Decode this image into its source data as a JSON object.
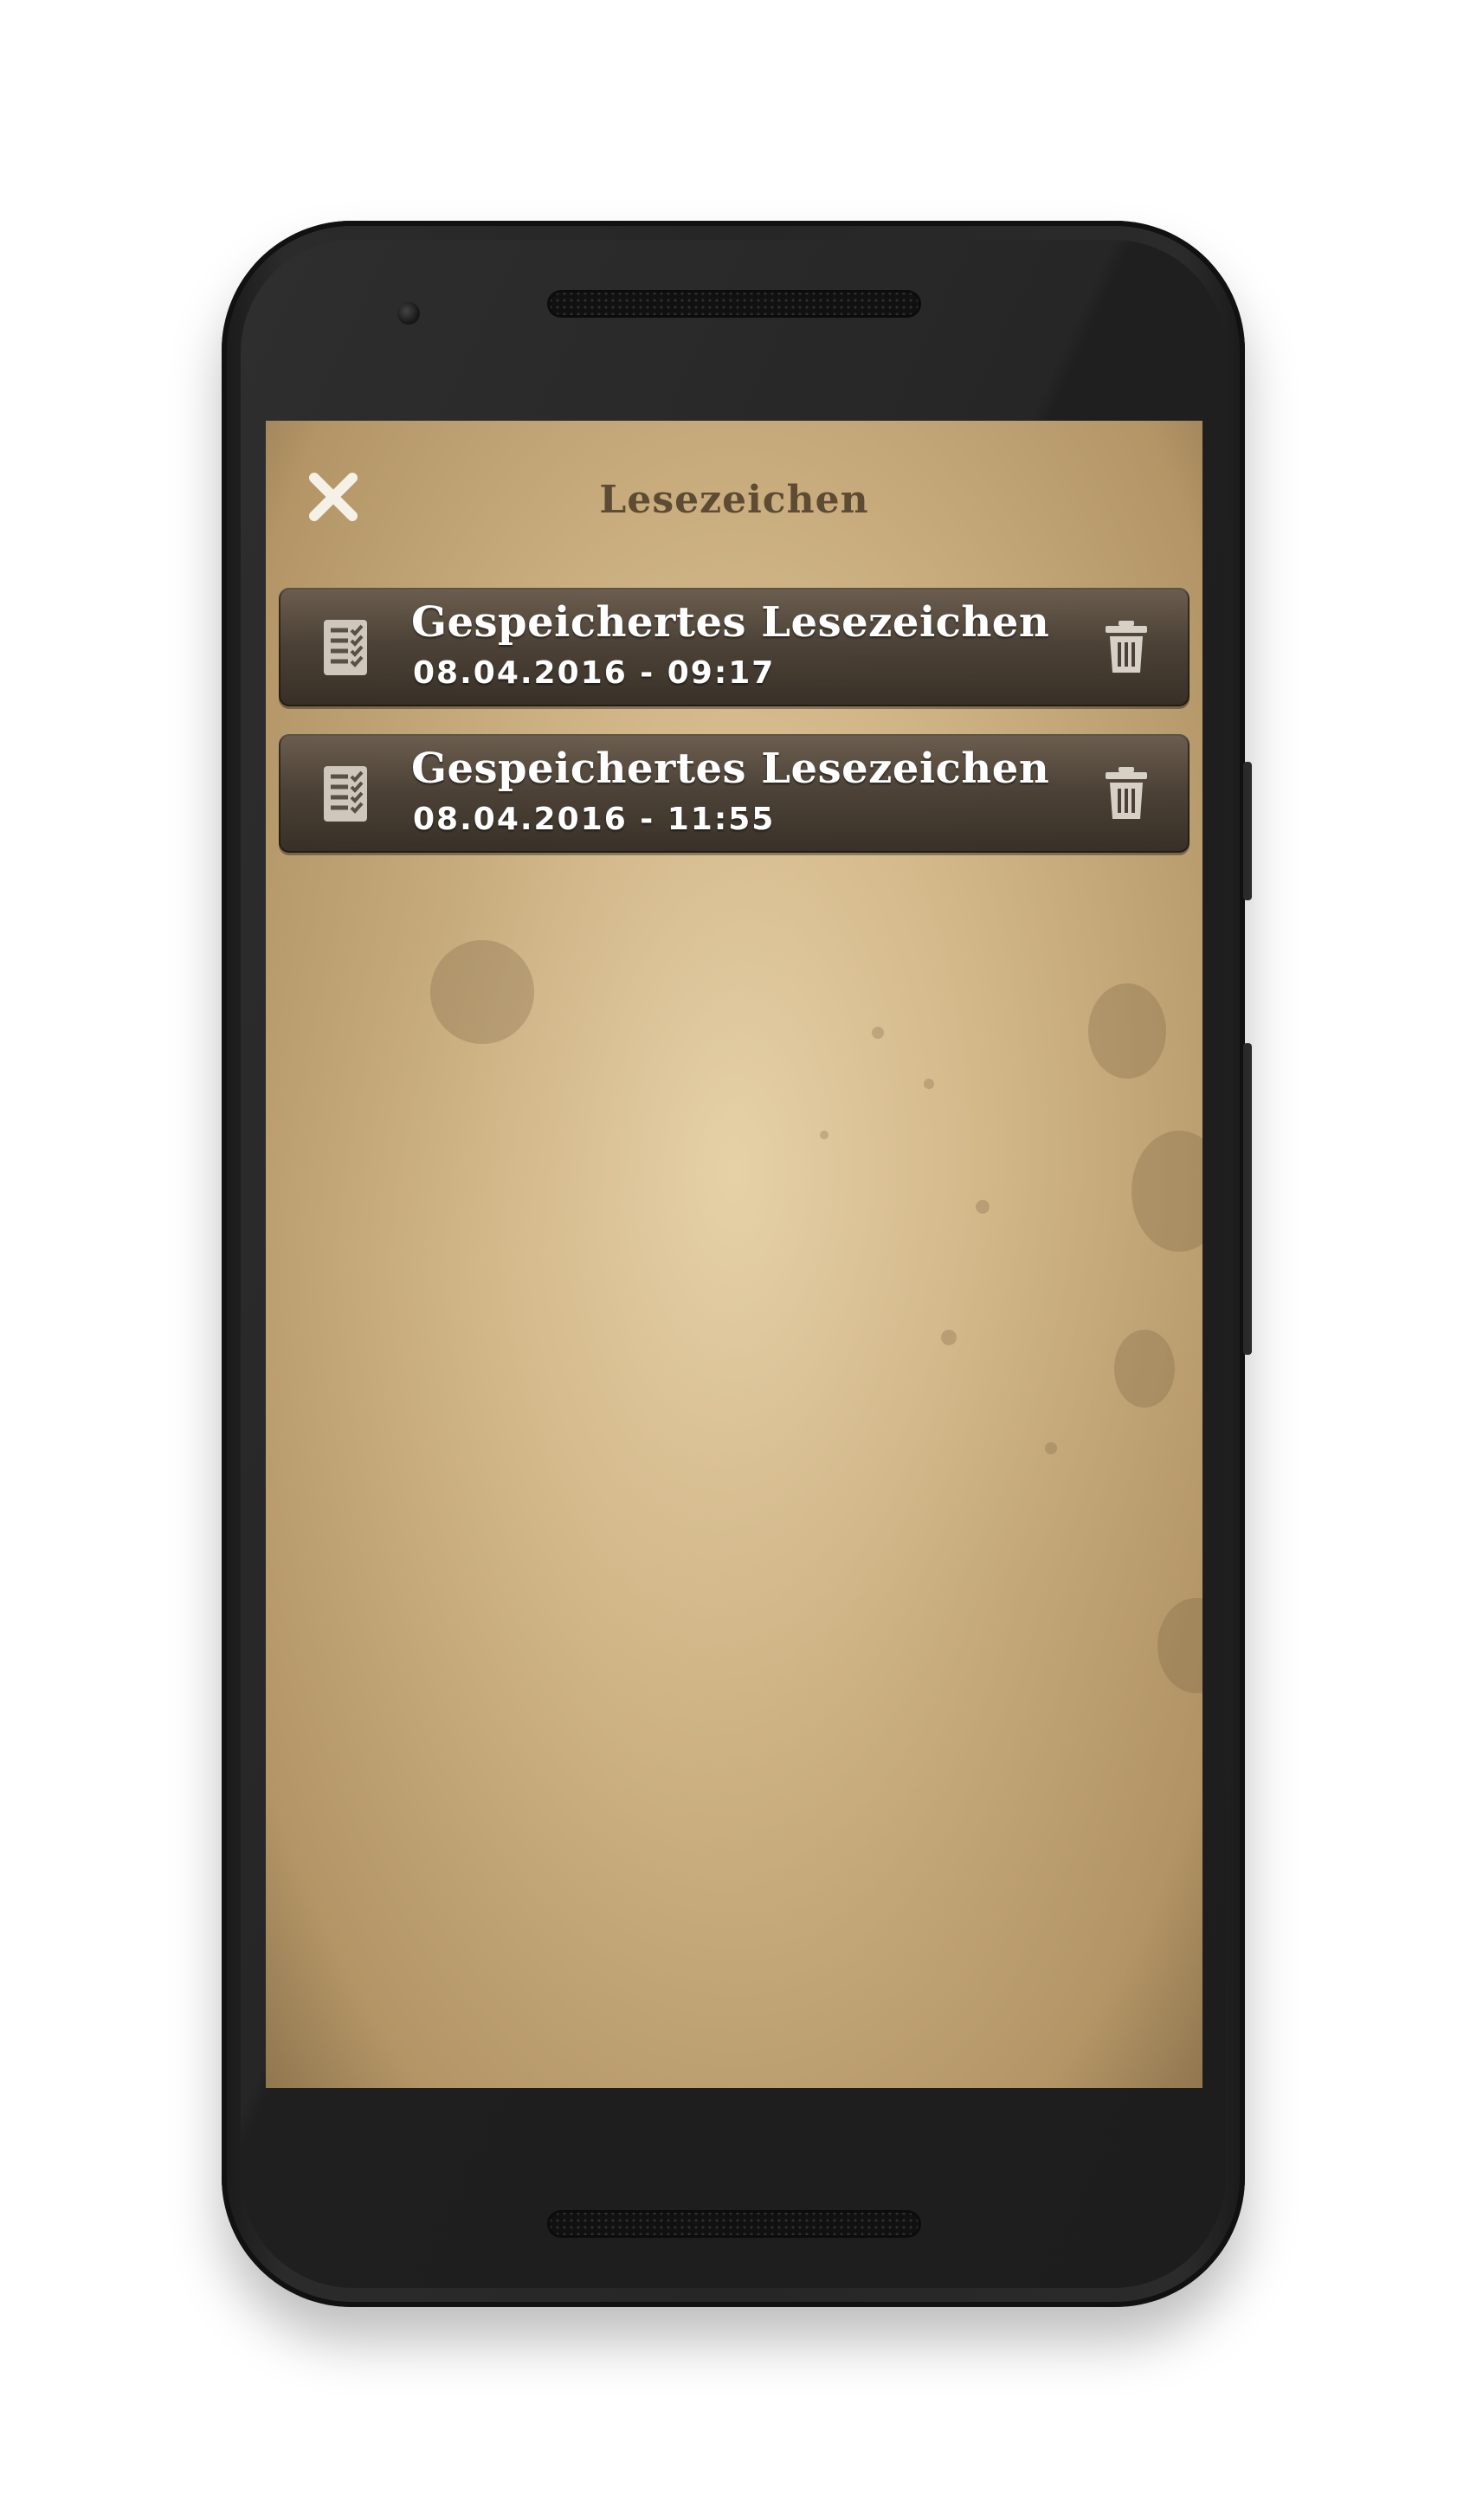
{
  "header": {
    "title": "Lesezeichen",
    "close_icon": "close-icon"
  },
  "bookmarks": [
    {
      "title": "Gespeichertes Lesezeichen",
      "datetime": "08.04.2016 - 09:17",
      "icon": "checklist-document-icon",
      "delete_icon": "trash-icon"
    },
    {
      "title": "Gespeichertes Lesezeichen",
      "datetime": "08.04.2016 - 11:55",
      "icon": "checklist-document-icon",
      "delete_icon": "trash-icon"
    }
  ],
  "colors": {
    "parchment": "#c9ab7a",
    "title_text": "#5e4b34",
    "item_bg": "#4a3f34",
    "item_text": "#ffffff",
    "device_body": "#262626"
  }
}
